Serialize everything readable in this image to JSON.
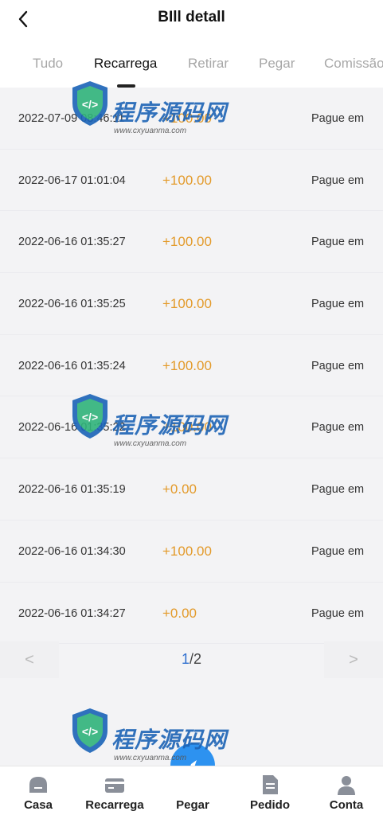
{
  "header": {
    "title": "BIll detall"
  },
  "tabs": [
    {
      "label": "Tudo",
      "active": false
    },
    {
      "label": "Recarrega",
      "active": true
    },
    {
      "label": "Retirar",
      "active": false
    },
    {
      "label": "Pegar",
      "active": false
    },
    {
      "label": "Comissão",
      "active": false
    }
  ],
  "records": [
    {
      "date": "2022-07-09 08:46:11",
      "amount": "+100.00",
      "status": "Pague em"
    },
    {
      "date": "2022-06-17 01:01:04",
      "amount": "+100.00",
      "status": "Pague em"
    },
    {
      "date": "2022-06-16 01:35:27",
      "amount": "+100.00",
      "status": "Pague em"
    },
    {
      "date": "2022-06-16 01:35:25",
      "amount": "+100.00",
      "status": "Pague em"
    },
    {
      "date": "2022-06-16 01:35:24",
      "amount": "+100.00",
      "status": "Pague em"
    },
    {
      "date": "2022-06-16 01:35:22",
      "amount": "+100.00",
      "status": "Pague em"
    },
    {
      "date": "2022-06-16 01:35:19",
      "amount": "+0.00",
      "status": "Pague em"
    },
    {
      "date": "2022-06-16 01:34:30",
      "amount": "+100.00",
      "status": "Pague em"
    },
    {
      "date": "2022-06-16 01:34:27",
      "amount": "+0.00",
      "status": "Pague em"
    }
  ],
  "pager": {
    "prev": "<",
    "next": ">",
    "current": "1",
    "total": "/2"
  },
  "watermark": {
    "text": "程序源码网",
    "url": "www.cxyuanma.com"
  },
  "tabbar": [
    {
      "label": "Casa",
      "icon": "home-icon"
    },
    {
      "label": "Recarrega",
      "icon": "wallet-icon"
    },
    {
      "label": "Pegar",
      "icon": "compass-icon"
    },
    {
      "label": "Pedido",
      "icon": "document-icon"
    },
    {
      "label": "Conta",
      "icon": "user-icon"
    }
  ],
  "colors": {
    "amount": "#e39a2a",
    "accent": "#2f6fcf",
    "center_button": "#2d92f0"
  }
}
